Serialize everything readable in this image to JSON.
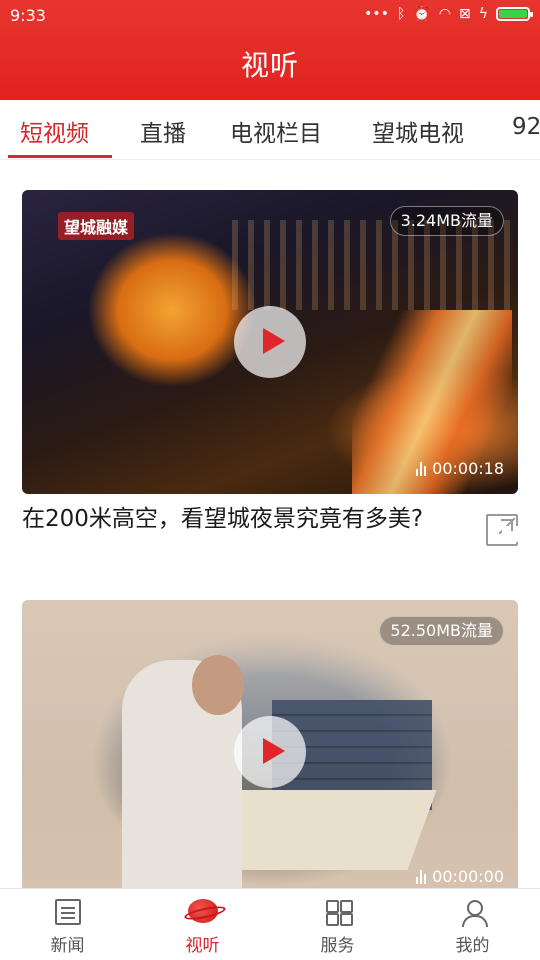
{
  "status_bar": {
    "time": "9:33",
    "icons": [
      "more-dots-icon",
      "bluetooth-icon",
      "alarm-icon",
      "wifi-icon",
      "sim-icon",
      "charging-icon",
      "battery-icon"
    ]
  },
  "header": {
    "title": "视听"
  },
  "tabs": [
    {
      "label": "短视频",
      "active": true
    },
    {
      "label": "直播",
      "active": false
    },
    {
      "label": "电视栏目",
      "active": false
    },
    {
      "label": "望城电视",
      "active": false
    },
    {
      "label": "92",
      "active": false
    }
  ],
  "videos": [
    {
      "title": "在200米高空，看望城夜景究竟有多美?",
      "data_usage": "3.24MB流量",
      "duration": "00:00:18",
      "watermark": "望城融媒"
    },
    {
      "title": "",
      "data_usage": "52.50MB流量",
      "duration": "00:00:00"
    }
  ],
  "bottom_nav": [
    {
      "label": "新闻",
      "icon": "news-icon",
      "active": false
    },
    {
      "label": "视听",
      "icon": "planet-icon",
      "active": true
    },
    {
      "label": "服务",
      "icon": "grid-icon",
      "active": false
    },
    {
      "label": "我的",
      "icon": "person-icon",
      "active": false
    }
  ],
  "colors": {
    "accent": "#d7262d",
    "header": "#e1221f"
  }
}
